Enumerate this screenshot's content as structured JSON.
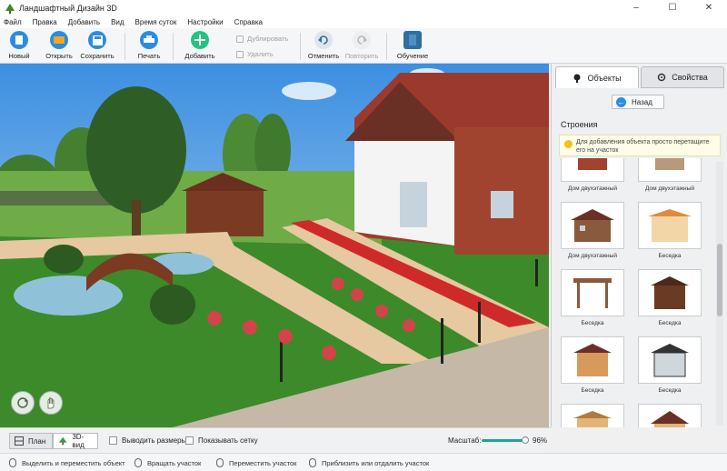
{
  "window": {
    "title": "Ландшафтный Дизайн 3D",
    "min": "–",
    "max": "☐",
    "close": "✕"
  },
  "menu": [
    "Файл",
    "Правка",
    "Добавить",
    "Вид",
    "Время суток",
    "Настройки",
    "Справка"
  ],
  "toolbar": {
    "new": "Новый",
    "open": "Открыть",
    "save": "Сохранить",
    "print": "Печать",
    "add": "Добавить",
    "duplicate": "Дублировать",
    "delete": "Удалить",
    "undo": "Отменить",
    "redo": "Повторить",
    "tutorial": "Обучение"
  },
  "colors": {
    "accent": "#2b8de0",
    "folder": "#f5a623",
    "add": "#26c281",
    "grass": "#3c8a2a",
    "brick": "#9b3a2c"
  },
  "panel": {
    "tab_objects": "Объекты",
    "tab_properties": "Свойства",
    "back": "Назад",
    "section": "Строения",
    "hint": "Для добавления объекта просто перетащите его на участок",
    "items": [
      {
        "label": "Дом двухэтажный",
        "icon": "house-icon"
      },
      {
        "label": "Дом двухэтажный",
        "icon": "house-icon"
      },
      {
        "label": "Дом двухэтажный",
        "icon": "house-icon"
      },
      {
        "label": "Беседка",
        "icon": "gazebo-icon"
      },
      {
        "label": "Беседка",
        "icon": "gazebo-icon"
      },
      {
        "label": "Беседка",
        "icon": "gazebo-icon"
      },
      {
        "label": "Беседка",
        "icon": "gazebo-icon"
      },
      {
        "label": "Беседка",
        "icon": "gazebo-icon"
      },
      {
        "label": "",
        "icon": "shed-icon"
      },
      {
        "label": "",
        "icon": "house-icon"
      }
    ]
  },
  "bottom": {
    "plan": "План",
    "view3d": "3D-вид",
    "show_sizes": "Выводить размеры",
    "show_grid": "Показывать сетку",
    "zoom_label": "Масштаб:",
    "zoom_value": "96%",
    "zoom_level": 0.96
  },
  "status": {
    "select": "Выделить и переместить объект",
    "rotate": "Вращать участок",
    "move": "Переместить участок",
    "zoom": "Приблизить или отдалить участок"
  }
}
